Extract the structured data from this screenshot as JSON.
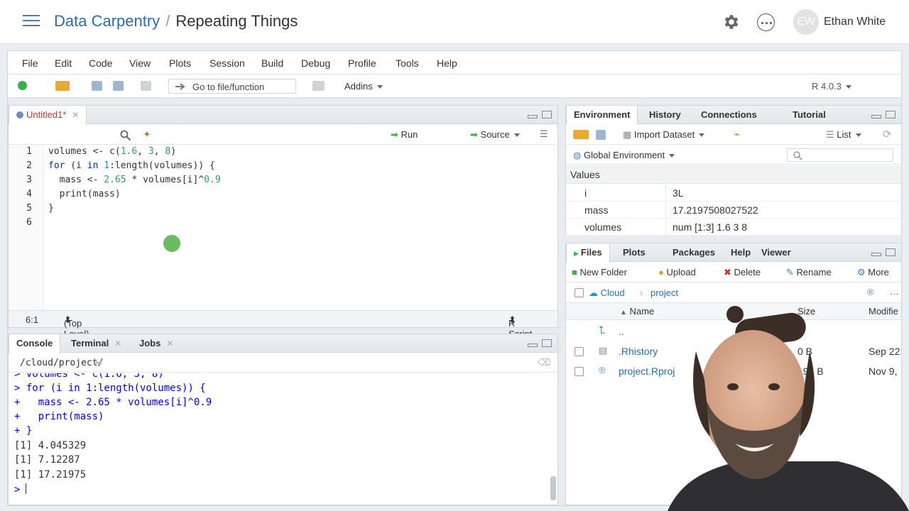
{
  "header": {
    "course": "Data Carpentry",
    "separator": "/",
    "project": "Repeating Things",
    "avatar_initials": "EW",
    "user_name": "Ethan White"
  },
  "menu": [
    "File",
    "Edit",
    "Code",
    "View",
    "Plots",
    "Session",
    "Build",
    "Debug",
    "Profile",
    "Tools",
    "Help"
  ],
  "toolbar": {
    "goto_label": "Go to file/function",
    "addins_label": "Addins",
    "r_version": "R 4.0.3"
  },
  "editor": {
    "tab_title": "Untitled1*",
    "run_label": "Run",
    "source_label": "Source",
    "status_position": "6:1",
    "status_scope": "(Top Level)",
    "status_type": "R Script",
    "line_numbers": [
      "1",
      "2",
      "3",
      "4",
      "5",
      "6"
    ]
  },
  "console": {
    "tabs": [
      "Console",
      "Terminal",
      "Jobs"
    ],
    "path": "/cloud/project/",
    "lines": [
      "> volumes <- c(1.6, 3, 8)",
      "> for (i in 1:length(volumes)) {",
      "+   mass <- 2.65 * volumes[i]^0.9",
      "+   print(mass)",
      "+ }",
      "[1] 4.045329",
      "[1] 7.12287",
      "[1] 17.21975",
      ">"
    ]
  },
  "environment": {
    "tabs": [
      "Environment",
      "History",
      "Connections",
      "Tutorial"
    ],
    "import_label": "Import Dataset",
    "list_label": "List",
    "scope_label": "Global Environment",
    "section": "Values",
    "rows": [
      {
        "name": "i",
        "value": "3L"
      },
      {
        "name": "mass",
        "value": "17.2197508027522"
      },
      {
        "name": "volumes",
        "value": "num [1:3] 1.6 3 8"
      }
    ]
  },
  "files": {
    "tabs": [
      "Files",
      "Plots",
      "Packages",
      "Help",
      "Viewer"
    ],
    "actions": [
      "New Folder",
      "Upload",
      "Delete",
      "Rename",
      "More"
    ],
    "breadcrumb_root": "Cloud",
    "breadcrumb_dir": "project",
    "col_name": "Name",
    "col_size": "Size",
    "col_modified": "Modifie",
    "parent": "..",
    "rows": [
      {
        "name": ".Rhistory",
        "size": "0 B",
        "modified": "Sep 22"
      },
      {
        "name": "project.Rproj",
        "size": "191 B",
        "modified": "Nov 9,"
      }
    ]
  },
  "colors": {
    "accent": "#2d6ca8",
    "number": "#2e9c6a",
    "keyword": "#0033b3",
    "prompt": "#0000ee"
  }
}
